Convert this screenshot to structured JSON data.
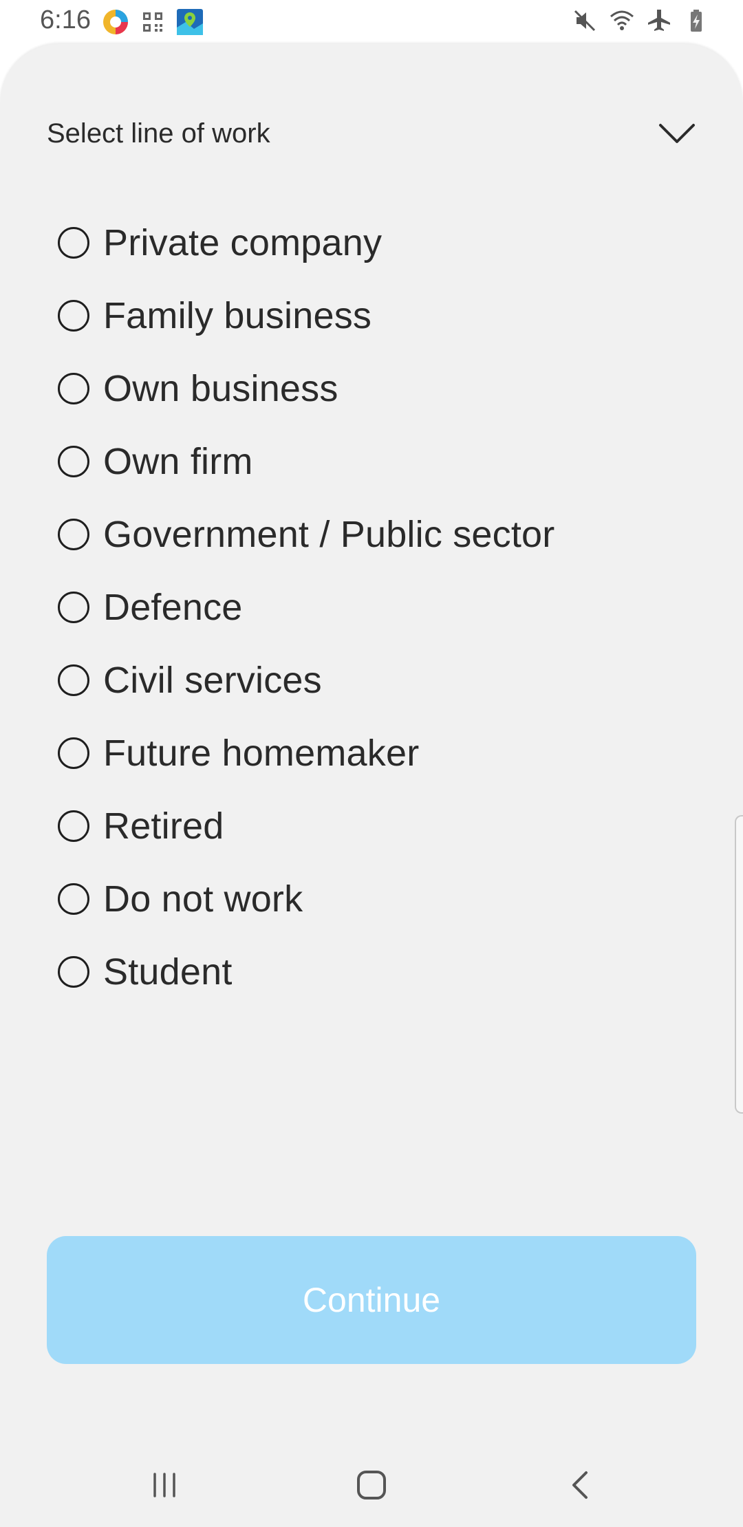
{
  "status_bar": {
    "time": "6:16",
    "app_icons": [
      "chrome-like-app-icon",
      "qr-code-icon",
      "maps-icon"
    ],
    "system_icons": [
      "mute-icon",
      "wifi-icon",
      "airplane-mode-icon",
      "battery-charging-icon"
    ]
  },
  "sheet": {
    "title": "Select line of work",
    "options": [
      {
        "label": "Private company",
        "selected": false
      },
      {
        "label": "Family business",
        "selected": false
      },
      {
        "label": "Own business",
        "selected": false
      },
      {
        "label": "Own firm",
        "selected": false
      },
      {
        "label": "Government / Public sector",
        "selected": false
      },
      {
        "label": "Defence",
        "selected": false
      },
      {
        "label": "Civil services",
        "selected": false
      },
      {
        "label": "Future homemaker",
        "selected": false
      },
      {
        "label": "Retired",
        "selected": false
      },
      {
        "label": "Do not work",
        "selected": false
      },
      {
        "label": "Student",
        "selected": false
      }
    ],
    "continue_label": "Continue",
    "continue_color": "#a0daf9"
  },
  "nav_bar": {
    "icons": [
      "recents-icon",
      "home-icon",
      "back-icon"
    ]
  }
}
